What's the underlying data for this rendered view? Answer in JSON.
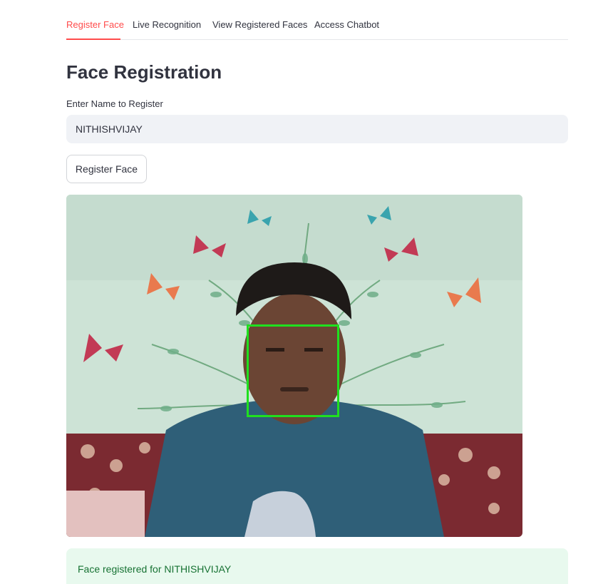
{
  "tabs": [
    {
      "label": "Register Face",
      "active": true
    },
    {
      "label": "Live Recognition",
      "active": false
    },
    {
      "label": "View Registered Faces",
      "active": false
    },
    {
      "label": "Access Chatbot",
      "active": false
    }
  ],
  "page_title": "Face Registration",
  "name_field": {
    "label": "Enter Name to Register",
    "value": "NITHISHVIJAY"
  },
  "register_button": {
    "label": "Register Face"
  },
  "camera": {
    "detection_box_color": "#1fe01f"
  },
  "success_message": "Face registered for NITHISHVIJAY",
  "colors": {
    "accent": "#ff4b4b",
    "success_bg": "#e8f9ee",
    "success_text": "#177233"
  }
}
